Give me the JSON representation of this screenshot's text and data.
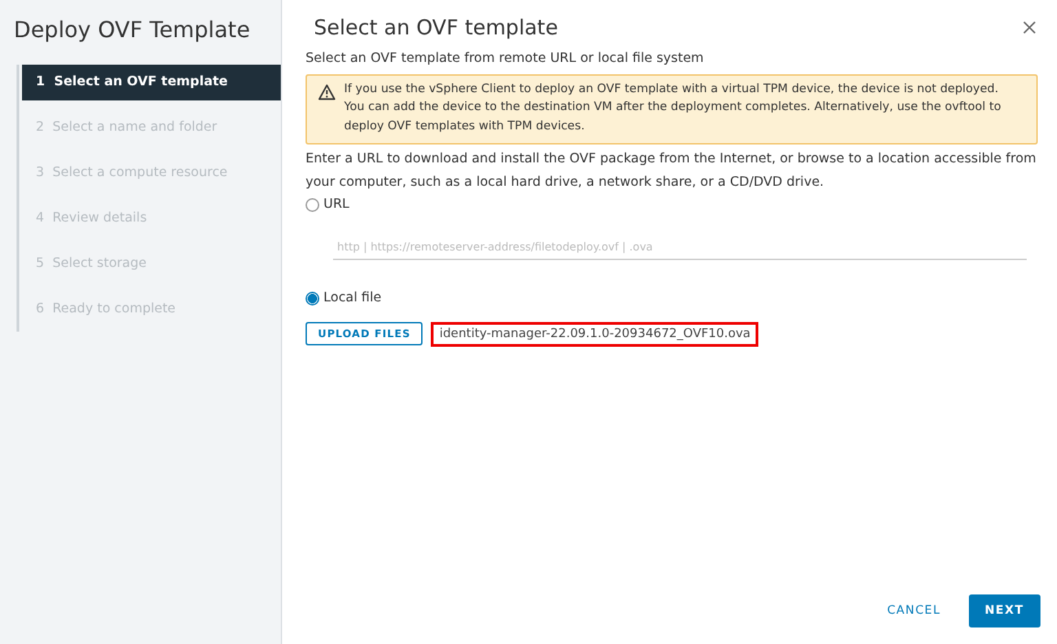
{
  "wizard": {
    "title": "Deploy OVF Template"
  },
  "steps": [
    {
      "number": "1",
      "label": "Select an OVF template",
      "selected": true
    },
    {
      "number": "2",
      "label": "Select a name and folder",
      "selected": false
    },
    {
      "number": "3",
      "label": "Select a compute resource",
      "selected": false
    },
    {
      "number": "4",
      "label": "Review details",
      "selected": false
    },
    {
      "number": "5",
      "label": "Select storage",
      "selected": false
    },
    {
      "number": "6",
      "label": "Ready to complete",
      "selected": false
    }
  ],
  "page": {
    "title": "Select an OVF template",
    "subtitle": "Select an OVF template from remote URL or local file system",
    "warning": "If you use the vSphere Client to deploy an OVF template with a virtual TPM device, the device is not deployed. You can add the device to the destination VM after the deployment completes. Alternatively, use the ovftool to deploy OVF templates with TPM devices.",
    "instructions": "Enter a URL to download and install the OVF package from the Internet, or browse to a location accessible from your computer, such as a local hard drive, a network share, or a CD/DVD drive."
  },
  "sources": [
    {
      "kind": "url",
      "label": "URL",
      "selected": false,
      "placeholder": "http | https://remoteserver-address/filetodeploy.ovf | .ova"
    },
    {
      "kind": "file",
      "label": "Local file",
      "selected": true,
      "button": "UPLOAD FILES",
      "file": "identity-manager-22.09.1.0-20934672_OVF10.ova"
    }
  ],
  "buttons": {
    "cancel": "CANCEL",
    "next": "NEXT"
  }
}
